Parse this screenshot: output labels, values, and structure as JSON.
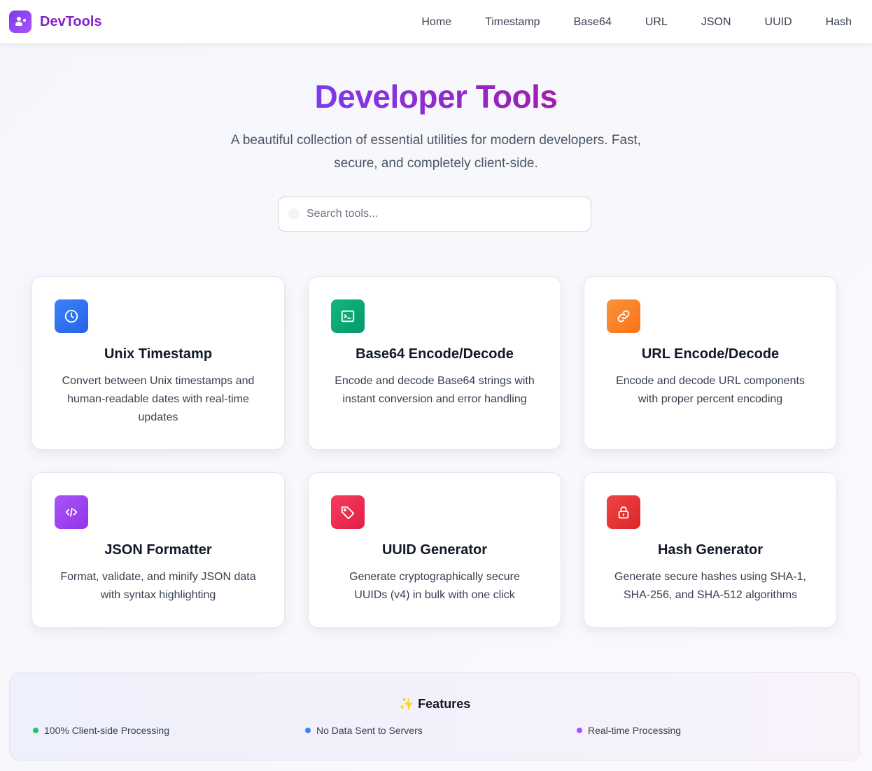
{
  "header": {
    "brand": "DevTools",
    "nav": [
      "Home",
      "Timestamp",
      "Base64",
      "URL",
      "JSON",
      "UUID",
      "Hash"
    ]
  },
  "hero": {
    "title": "Developer Tools",
    "subtitle": "A beautiful collection of essential utilities for modern developers. Fast, secure, and completely client-side."
  },
  "search": {
    "placeholder": "Search tools..."
  },
  "tools": [
    {
      "title": "Unix Timestamp",
      "description": "Convert between Unix timestamps and human-readable dates with real-time updates",
      "icon": "clock-icon",
      "color": "#2563eb"
    },
    {
      "title": "Base64 Encode/Decode",
      "description": "Encode and decode Base64 strings with instant conversion and error handling",
      "icon": "terminal-icon",
      "color": "#059669"
    },
    {
      "title": "URL Encode/Decode",
      "description": "Encode and decode URL components with proper percent encoding",
      "icon": "link-icon",
      "color": "#f97316"
    },
    {
      "title": "JSON Formatter",
      "description": "Format, validate, and minify JSON data with syntax highlighting",
      "icon": "code-icon",
      "color": "#9333ea"
    },
    {
      "title": "UUID Generator",
      "description": "Generate cryptographically secure UUIDs (v4) in bulk with one click",
      "icon": "tag-icon",
      "color": "#e11d48"
    },
    {
      "title": "Hash Generator",
      "description": "Generate secure hashes using SHA-1, SHA-256, and SHA-512 algorithms",
      "icon": "lock-icon",
      "color": "#dc2626"
    }
  ],
  "features": {
    "title": "✨ Features",
    "items": [
      {
        "label": "100% Client-side Processing",
        "color": "#22c55e"
      },
      {
        "label": "No Data Sent to Servers",
        "color": "#3b82f6"
      },
      {
        "label": "Real-time Processing",
        "color": "#a855f7"
      }
    ]
  }
}
